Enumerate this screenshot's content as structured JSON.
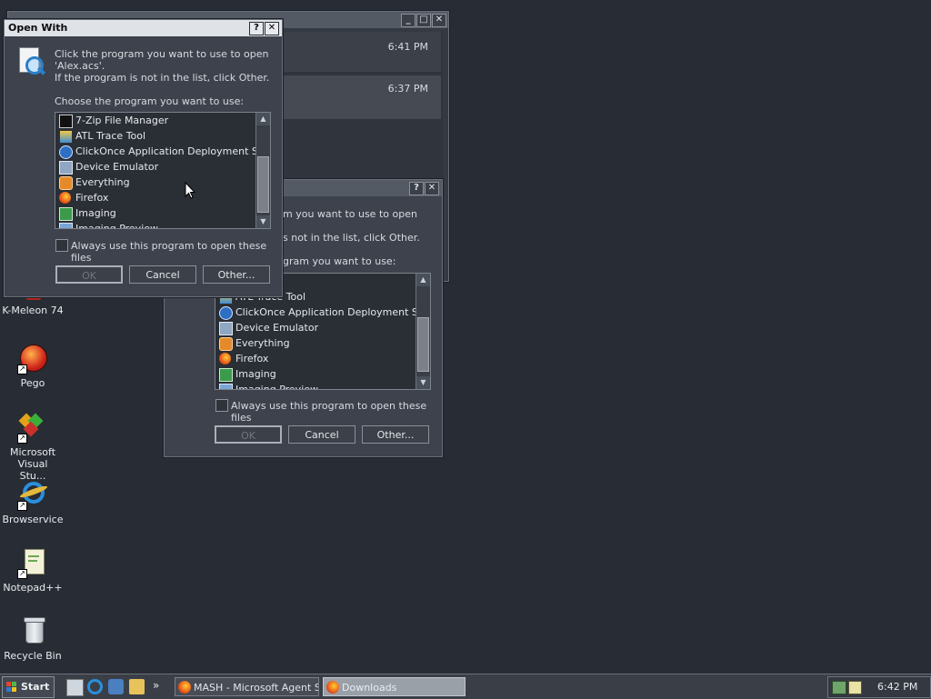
{
  "desktop": {
    "icons": [
      {
        "label": "K-Meleon 74",
        "icon": "kmeleon-icon"
      },
      {
        "label": "Pego",
        "icon": "pego-icon"
      },
      {
        "label": "Microsoft Visual Stu...",
        "icon": "visual-studio-icon"
      },
      {
        "label": "Browservice",
        "icon": "internet-explorer-icon"
      },
      {
        "label": "Notepad++",
        "icon": "notepadpp-icon"
      },
      {
        "label": "Recycle Bin",
        "icon": "recycle-bin-icon"
      }
    ]
  },
  "downloads_window": {
    "times": [
      "6:41 PM",
      "6:37 PM"
    ]
  },
  "dialog_front": {
    "title": "Open With",
    "help_btn": "?",
    "close_btn": "✕",
    "message_line1": "Click the program you want to use to open",
    "message_line2": "'Alex.acs'.",
    "message_line3": "If the program is not in the list, click Other.",
    "choose_label": "Choose the program you want to use:",
    "programs": [
      {
        "name": "7-Zip File Manager",
        "icon": "7zip-icon"
      },
      {
        "name": "ATL Trace Tool",
        "icon": "atl-trace-icon"
      },
      {
        "name": "ClickOnce Application Deployment Su...",
        "icon": "clickonce-icon"
      },
      {
        "name": "Device Emulator",
        "icon": "device-emulator-icon"
      },
      {
        "name": "Everything",
        "icon": "everything-icon"
      },
      {
        "name": "Firefox",
        "icon": "firefox-icon"
      },
      {
        "name": "Imaging",
        "icon": "imaging-icon"
      },
      {
        "name": "Imaging Preview",
        "icon": "imaging-preview-icon"
      }
    ],
    "always_use_label": "Always use this program to open these files",
    "ok_label": "OK",
    "cancel_label": "Cancel",
    "other_label": "Other..."
  },
  "dialog_back": {
    "help_btn": "?",
    "close_btn": "✕",
    "message_line1": "m you want to use to open",
    "message_line3": "s not in the list, click Other.",
    "choose_label": "gram you want to use:",
    "programs": [
      {
        "name": "Manager",
        "icon": "7zip-icon"
      },
      {
        "name": "ATL Trace Tool",
        "icon": "atl-trace-icon"
      },
      {
        "name": "ClickOnce Application Deployment Su...",
        "icon": "clickonce-icon"
      },
      {
        "name": "Device Emulator",
        "icon": "device-emulator-icon"
      },
      {
        "name": "Everything",
        "icon": "everything-icon"
      },
      {
        "name": "Firefox",
        "icon": "firefox-icon"
      },
      {
        "name": "Imaging",
        "icon": "imaging-icon"
      },
      {
        "name": "Imaging Preview",
        "icon": "imaging-preview-icon"
      }
    ],
    "always_use_label": "Always use this program to open these files",
    "ok_label": "OK",
    "cancel_label": "Cancel",
    "other_label": "Other..."
  },
  "taskbar": {
    "start_label": "Start",
    "chevron": "»",
    "tasks": [
      {
        "label": "MASH - Microsoft Agent S...",
        "icon": "firefox-icon",
        "active": false
      },
      {
        "label": "Downloads",
        "icon": "firefox-icon",
        "active": true
      }
    ],
    "clock": "6:42 PM"
  },
  "colors": {
    "desktop": "#282c34",
    "titlebar_active": "#dfe3e8",
    "titlebar_inactive": "#545a64",
    "window": "#3d424c"
  }
}
